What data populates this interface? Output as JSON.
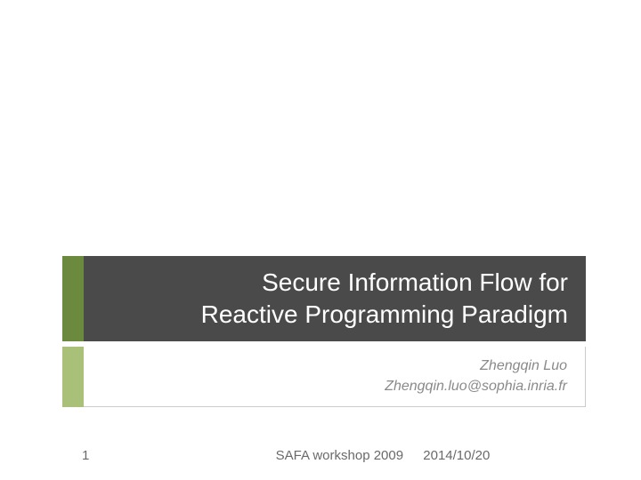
{
  "slide": {
    "title_line1": "Secure Information Flow for",
    "title_line2": "Reactive Programming Paradigm",
    "author_name": "Zhengqin Luo",
    "author_email": "Zhengqin.luo@sophia.inria.fr"
  },
  "footer": {
    "page_number": "1",
    "workshop": "SAFA workshop 2009",
    "date": "2014/10/20"
  },
  "colors": {
    "title_bg": "#4a4a4a",
    "accent_dark": "#6c8a3e",
    "accent_light": "#a8c078"
  }
}
